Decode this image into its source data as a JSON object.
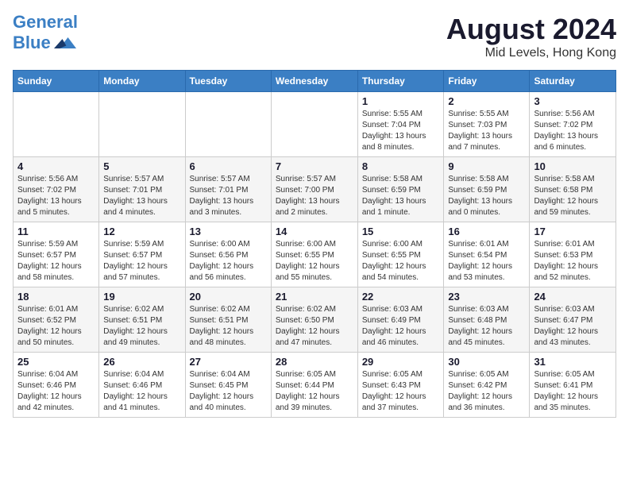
{
  "header": {
    "logo_line1": "General",
    "logo_line2": "Blue",
    "title": "August 2024",
    "subtitle": "Mid Levels, Hong Kong"
  },
  "calendar": {
    "columns": [
      "Sunday",
      "Monday",
      "Tuesday",
      "Wednesday",
      "Thursday",
      "Friday",
      "Saturday"
    ],
    "weeks": [
      [
        {
          "day": "",
          "info": ""
        },
        {
          "day": "",
          "info": ""
        },
        {
          "day": "",
          "info": ""
        },
        {
          "day": "",
          "info": ""
        },
        {
          "day": "1",
          "info": "Sunrise: 5:55 AM\nSunset: 7:04 PM\nDaylight: 13 hours\nand 8 minutes."
        },
        {
          "day": "2",
          "info": "Sunrise: 5:55 AM\nSunset: 7:03 PM\nDaylight: 13 hours\nand 7 minutes."
        },
        {
          "day": "3",
          "info": "Sunrise: 5:56 AM\nSunset: 7:02 PM\nDaylight: 13 hours\nand 6 minutes."
        }
      ],
      [
        {
          "day": "4",
          "info": "Sunrise: 5:56 AM\nSunset: 7:02 PM\nDaylight: 13 hours\nand 5 minutes."
        },
        {
          "day": "5",
          "info": "Sunrise: 5:57 AM\nSunset: 7:01 PM\nDaylight: 13 hours\nand 4 minutes."
        },
        {
          "day": "6",
          "info": "Sunrise: 5:57 AM\nSunset: 7:01 PM\nDaylight: 13 hours\nand 3 minutes."
        },
        {
          "day": "7",
          "info": "Sunrise: 5:57 AM\nSunset: 7:00 PM\nDaylight: 13 hours\nand 2 minutes."
        },
        {
          "day": "8",
          "info": "Sunrise: 5:58 AM\nSunset: 6:59 PM\nDaylight: 13 hours\nand 1 minute."
        },
        {
          "day": "9",
          "info": "Sunrise: 5:58 AM\nSunset: 6:59 PM\nDaylight: 13 hours\nand 0 minutes."
        },
        {
          "day": "10",
          "info": "Sunrise: 5:58 AM\nSunset: 6:58 PM\nDaylight: 12 hours\nand 59 minutes."
        }
      ],
      [
        {
          "day": "11",
          "info": "Sunrise: 5:59 AM\nSunset: 6:57 PM\nDaylight: 12 hours\nand 58 minutes."
        },
        {
          "day": "12",
          "info": "Sunrise: 5:59 AM\nSunset: 6:57 PM\nDaylight: 12 hours\nand 57 minutes."
        },
        {
          "day": "13",
          "info": "Sunrise: 6:00 AM\nSunset: 6:56 PM\nDaylight: 12 hours\nand 56 minutes."
        },
        {
          "day": "14",
          "info": "Sunrise: 6:00 AM\nSunset: 6:55 PM\nDaylight: 12 hours\nand 55 minutes."
        },
        {
          "day": "15",
          "info": "Sunrise: 6:00 AM\nSunset: 6:55 PM\nDaylight: 12 hours\nand 54 minutes."
        },
        {
          "day": "16",
          "info": "Sunrise: 6:01 AM\nSunset: 6:54 PM\nDaylight: 12 hours\nand 53 minutes."
        },
        {
          "day": "17",
          "info": "Sunrise: 6:01 AM\nSunset: 6:53 PM\nDaylight: 12 hours\nand 52 minutes."
        }
      ],
      [
        {
          "day": "18",
          "info": "Sunrise: 6:01 AM\nSunset: 6:52 PM\nDaylight: 12 hours\nand 50 minutes."
        },
        {
          "day": "19",
          "info": "Sunrise: 6:02 AM\nSunset: 6:51 PM\nDaylight: 12 hours\nand 49 minutes."
        },
        {
          "day": "20",
          "info": "Sunrise: 6:02 AM\nSunset: 6:51 PM\nDaylight: 12 hours\nand 48 minutes."
        },
        {
          "day": "21",
          "info": "Sunrise: 6:02 AM\nSunset: 6:50 PM\nDaylight: 12 hours\nand 47 minutes."
        },
        {
          "day": "22",
          "info": "Sunrise: 6:03 AM\nSunset: 6:49 PM\nDaylight: 12 hours\nand 46 minutes."
        },
        {
          "day": "23",
          "info": "Sunrise: 6:03 AM\nSunset: 6:48 PM\nDaylight: 12 hours\nand 45 minutes."
        },
        {
          "day": "24",
          "info": "Sunrise: 6:03 AM\nSunset: 6:47 PM\nDaylight: 12 hours\nand 43 minutes."
        }
      ],
      [
        {
          "day": "25",
          "info": "Sunrise: 6:04 AM\nSunset: 6:46 PM\nDaylight: 12 hours\nand 42 minutes."
        },
        {
          "day": "26",
          "info": "Sunrise: 6:04 AM\nSunset: 6:46 PM\nDaylight: 12 hours\nand 41 minutes."
        },
        {
          "day": "27",
          "info": "Sunrise: 6:04 AM\nSunset: 6:45 PM\nDaylight: 12 hours\nand 40 minutes."
        },
        {
          "day": "28",
          "info": "Sunrise: 6:05 AM\nSunset: 6:44 PM\nDaylight: 12 hours\nand 39 minutes."
        },
        {
          "day": "29",
          "info": "Sunrise: 6:05 AM\nSunset: 6:43 PM\nDaylight: 12 hours\nand 37 minutes."
        },
        {
          "day": "30",
          "info": "Sunrise: 6:05 AM\nSunset: 6:42 PM\nDaylight: 12 hours\nand 36 minutes."
        },
        {
          "day": "31",
          "info": "Sunrise: 6:05 AM\nSunset: 6:41 PM\nDaylight: 12 hours\nand 35 minutes."
        }
      ]
    ]
  }
}
